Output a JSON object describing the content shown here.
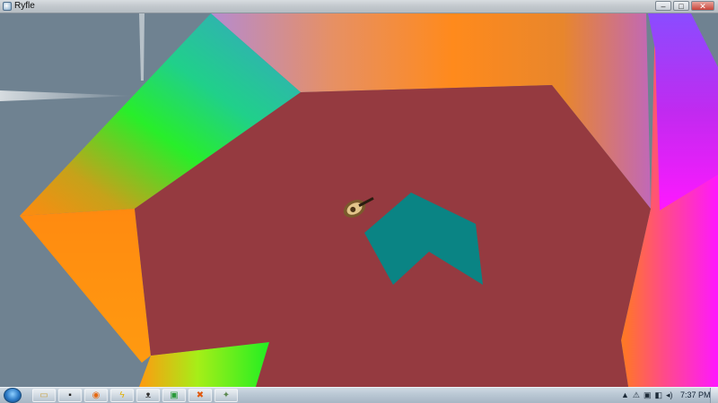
{
  "window": {
    "title": "Ryfle",
    "controls": {
      "minimize": "–",
      "maximize": "□",
      "close": "✕"
    }
  },
  "game": {
    "colors": {
      "background": "#6f8291",
      "floor": "#953a40",
      "obstacle": "#0a8484",
      "border_orange": "#ff8a10",
      "border_green": "#22ee22",
      "border_magenta": "#ff16ff",
      "border_purple": "#8b4bff",
      "left_strip": "#b8def0"
    },
    "player": {
      "sprite": "tank-icon"
    }
  },
  "taskbar": {
    "buttons": [
      {
        "icon": "folder-icon",
        "glyph": "▭",
        "color": "#c8a44a"
      },
      {
        "icon": "terminal-icon",
        "glyph": "▪",
        "color": "#222222"
      },
      {
        "icon": "firefox-icon",
        "glyph": "◉",
        "color": "#e66a12"
      },
      {
        "icon": "winamp-icon",
        "glyph": "ϟ",
        "color": "#e0b000"
      },
      {
        "icon": "bunny-icon",
        "glyph": "ᴥ",
        "color": "#333333"
      },
      {
        "icon": "chat-icon",
        "glyph": "▣",
        "color": "#2a9a3a"
      },
      {
        "icon": "tool-icon",
        "glyph": "✖",
        "color": "#e05a10"
      },
      {
        "icon": "game-icon",
        "glyph": "✦",
        "color": "#5d8a52"
      }
    ],
    "tray_icons": [
      "▲",
      "⚠",
      "▣",
      "◧",
      "◂)"
    ],
    "clock": "7:37 PM"
  }
}
